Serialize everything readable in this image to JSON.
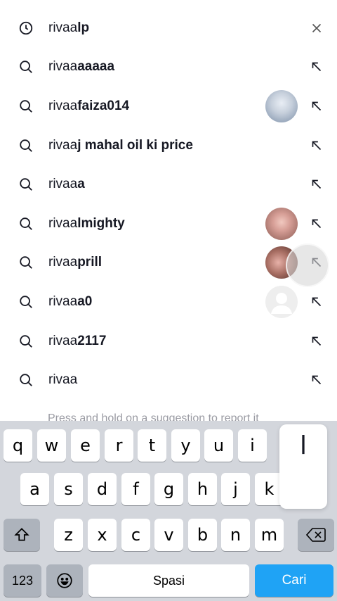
{
  "suggestions": [
    {
      "typed": "rivaa",
      "rest": "lp",
      "lead_icon": "clock-icon",
      "trail_icon": "close-icon",
      "thumb": null
    },
    {
      "typed": "rivaa",
      "rest": "aaaaa",
      "lead_icon": "search-icon",
      "trail_icon": "arrow-up-left-icon",
      "thumb": null
    },
    {
      "typed": "rivaa",
      "rest": "faiza014",
      "lead_icon": "search-icon",
      "trail_icon": "arrow-up-left-icon",
      "thumb": "profile-thumbnail"
    },
    {
      "typed": "rivaa",
      "rest": "j mahal oil ki price",
      "lead_icon": "search-icon",
      "trail_icon": "arrow-up-left-icon",
      "thumb": null
    },
    {
      "typed": "rivaa",
      "rest": "a",
      "lead_icon": "search-icon",
      "trail_icon": "arrow-up-left-icon",
      "thumb": null
    },
    {
      "typed": "rivaa",
      "rest": "lmighty",
      "lead_icon": "search-icon",
      "trail_icon": "arrow-up-left-icon",
      "thumb": "profile-thumbnail"
    },
    {
      "typed": "rivaa",
      "rest": "prill",
      "lead_icon": "search-icon",
      "trail_icon": "arrow-up-left-icon",
      "thumb": "profile-thumbnail"
    },
    {
      "typed": "rivaa",
      "rest": "a0",
      "lead_icon": "search-icon",
      "trail_icon": "arrow-up-left-icon",
      "thumb": "default-avatar"
    },
    {
      "typed": "rivaa",
      "rest": "2117",
      "lead_icon": "search-icon",
      "trail_icon": "arrow-up-left-icon",
      "thumb": null
    },
    {
      "typed": "rivaa",
      "rest": "",
      "lead_icon": "search-icon",
      "trail_icon": "arrow-up-left-icon",
      "thumb": null
    }
  ],
  "hint": "Press and hold on a suggestion to report it",
  "keyboard": {
    "row1": [
      "q",
      "w",
      "e",
      "r",
      "t",
      "y",
      "u",
      "i"
    ],
    "row2": [
      "a",
      "s",
      "d",
      "f",
      "g",
      "h",
      "j",
      "k"
    ],
    "row3": [
      "z",
      "x",
      "c",
      "v",
      "b",
      "n",
      "m"
    ],
    "popup_key": "l",
    "numbers_label": "123",
    "space_label": "Spasi",
    "search_label": "Cari",
    "shift_icon": "shift-icon",
    "backspace_icon": "backspace-icon",
    "emoji_icon": "emoji-icon"
  },
  "colors": {
    "accent": "#1fa3f5",
    "keyboard_bg": "#d3d6dc",
    "hint_text": "#9a9ba3"
  }
}
